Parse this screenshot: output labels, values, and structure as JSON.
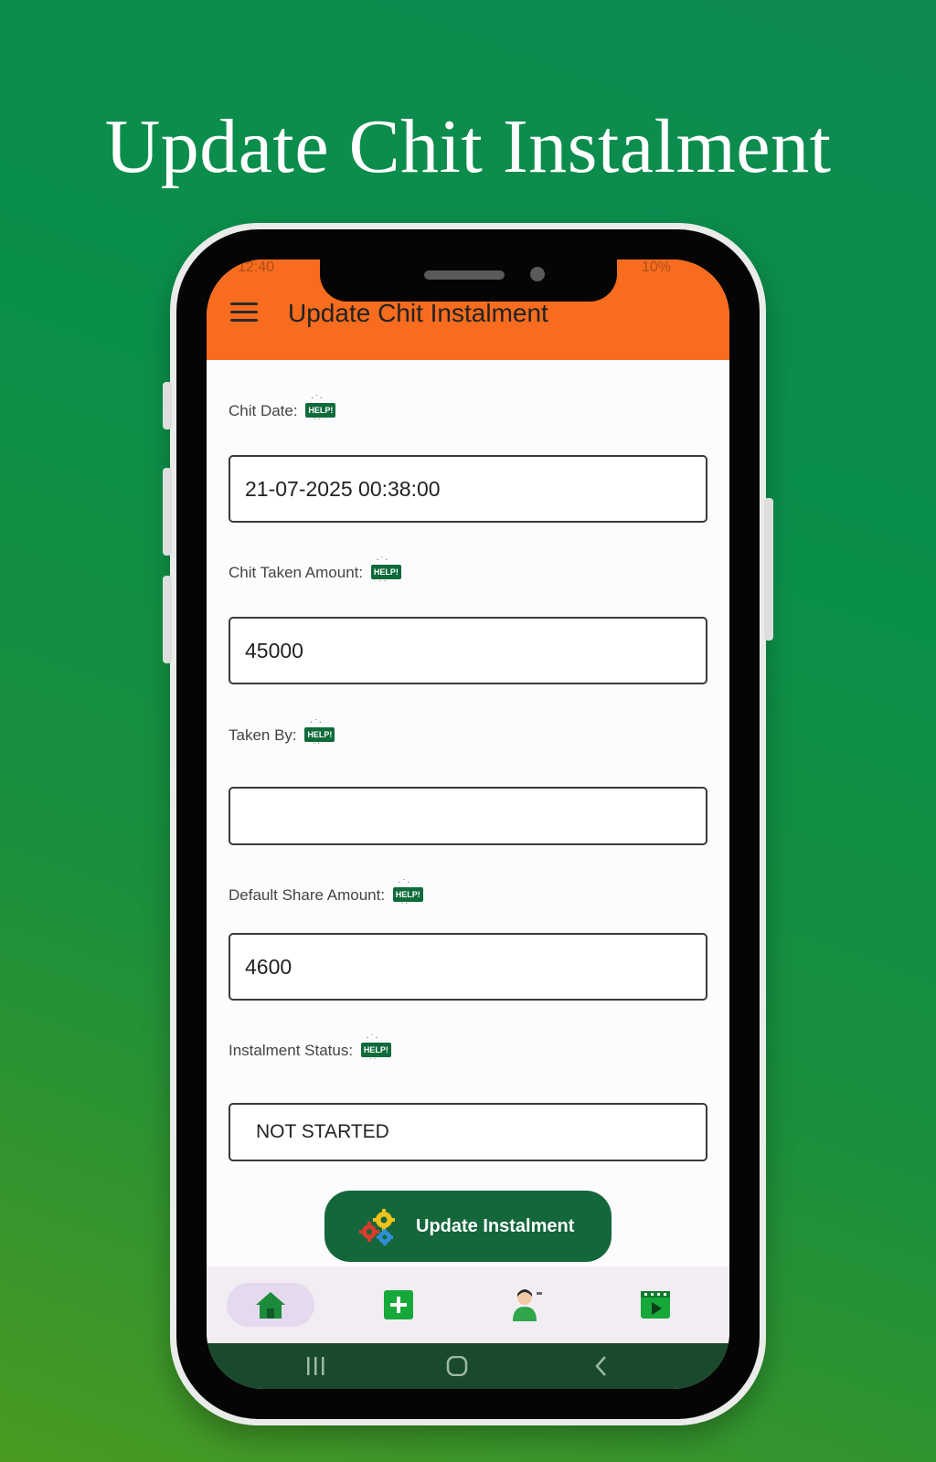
{
  "promo": {
    "title": "Update Chit Instalment"
  },
  "app_bar": {
    "title": "Update Chit Instalment",
    "status_left": "12:40",
    "status_right": "10%",
    "color": "#f76c1e"
  },
  "form": {
    "help_badge": "HELP!",
    "chit_date": {
      "label": "Chit Date:",
      "value": "21-07-2025 00:38:00"
    },
    "chit_taken_amount": {
      "label": "Chit Taken Amount:",
      "value": "45000"
    },
    "taken_by": {
      "label": "Taken By:",
      "value": ""
    },
    "default_share_amount": {
      "label": "Default Share Amount:",
      "value": "4600"
    },
    "instalment_status": {
      "label": "Instalment Status:",
      "value": "NOT STARTED"
    }
  },
  "update_button": {
    "label": "Update Instalment",
    "icon": "gears-icon",
    "color": "#14663b"
  },
  "bottom_nav": {
    "items": [
      {
        "icon": "home-icon",
        "active": true
      },
      {
        "icon": "add-icon",
        "active": false
      },
      {
        "icon": "support-agent-icon",
        "active": false
      },
      {
        "icon": "video-icon",
        "active": false
      }
    ]
  },
  "system_nav": {
    "items": [
      "recents-icon",
      "home-circle-icon",
      "back-icon"
    ]
  },
  "colors": {
    "background_green": "#0a8f4a",
    "accent_green": "#0f6b3a"
  }
}
